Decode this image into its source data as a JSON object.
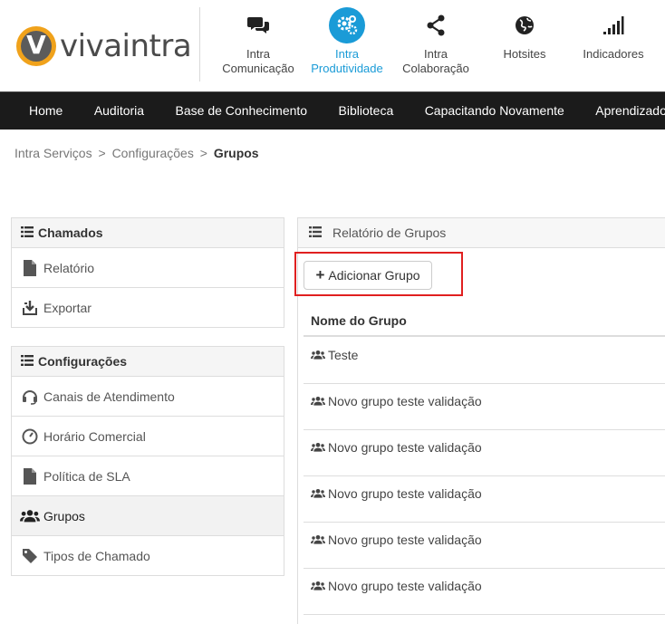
{
  "brand": {
    "name": "vivaintra",
    "mark": "V"
  },
  "top_nav": [
    {
      "line1": "Intra",
      "line2": "Comunicação",
      "icon": "chat-icon",
      "active": false
    },
    {
      "line1": "Intra",
      "line2": "Produtividade",
      "icon": "gears-icon",
      "active": true
    },
    {
      "line1": "Intra",
      "line2": "Colaboração",
      "icon": "share-icon",
      "active": false
    },
    {
      "line1": "Hotsites",
      "line2": "",
      "icon": "globe-icon",
      "active": false
    },
    {
      "line1": "Indicadores",
      "line2": "",
      "icon": "signal-icon",
      "active": false
    }
  ],
  "main_nav": [
    "Home",
    "Auditoria",
    "Base de Conhecimento",
    "Biblioteca",
    "Capacitando Novamente",
    "Aprendizado Fá"
  ],
  "breadcrumb": {
    "items": [
      "Intra Serviços",
      "Configurações"
    ],
    "current": "Grupos",
    "separator": ">"
  },
  "sidebar": {
    "chamados": {
      "title": "Chamados",
      "items": [
        {
          "label": "Relatório",
          "icon": "file-icon"
        },
        {
          "label": "Exportar",
          "icon": "download-icon"
        }
      ]
    },
    "configuracoes": {
      "title": "Configurações",
      "items": [
        {
          "label": "Canais de Atendimento",
          "icon": "headset-icon"
        },
        {
          "label": "Horário Comercial",
          "icon": "clock-icon"
        },
        {
          "label": "Política de SLA",
          "icon": "file-icon"
        },
        {
          "label": "Grupos",
          "icon": "users-icon",
          "active": true
        },
        {
          "label": "Tipos de Chamado",
          "icon": "tag-icon"
        }
      ]
    }
  },
  "main": {
    "panel_title": "Relatório de Grupos",
    "add_button": {
      "plus": "+",
      "label": "Adicionar Grupo"
    },
    "table": {
      "header": "Nome do Grupo",
      "rows": [
        "Teste",
        "Novo grupo teste validação",
        "Novo grupo teste validação",
        "Novo grupo teste validação",
        "Novo grupo teste validação",
        "Novo grupo teste validação"
      ]
    }
  },
  "colors": {
    "accent": "#1a9bd7",
    "nav_bg": "#1b1b1b",
    "highlight": "#e02020",
    "logo_orange": "#f0a21b"
  }
}
